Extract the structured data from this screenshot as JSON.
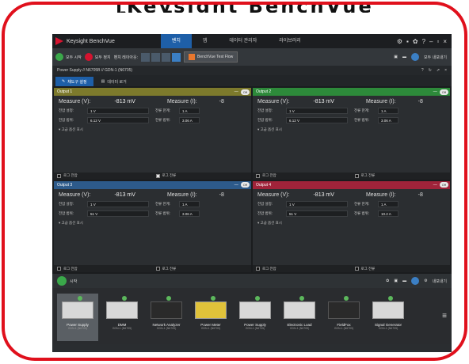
{
  "banner": {
    "text": "[Keysight BenchVue App]"
  },
  "app": {
    "title": "Keysight BenchVue",
    "tabs": [
      "벤치",
      "앱",
      "데이터 관리자",
      "라이브러리"
    ],
    "active_tab": "벤치"
  },
  "toolbar": {
    "start_label": "모두 시작",
    "stop_label": "모두 정지",
    "layout_label": "벤치 레이아웃:",
    "flow_label": "BenchVue Test Flow",
    "export_label": "모두 내보내기"
  },
  "instrument_bar": {
    "title": "Power Supply // N6705B // GDN-1 (N6705)"
  },
  "view_tabs": {
    "settings": "채도구 설정",
    "data_log": "데이터 로거"
  },
  "outputs": [
    {
      "name": "Output 1",
      "color": "#7d7a2c",
      "state": "Off",
      "measure_v_label": "Measure (V):",
      "measure_v": "-813 mV",
      "measure_i_label": "Measure (I):",
      "measure_i_partial": "-8",
      "voltage_set_label": "전압 설정:",
      "voltage_set": "1 V",
      "current_limit_label": "전류 한계:",
      "current_limit": "1 A",
      "voltage_range_label": "전압 범위:",
      "voltage_range": "6.12 V",
      "current_range_label": "전류 범위:",
      "current_range": "3.06 A",
      "advanced_label": "고급 옵션 표시",
      "log_v_label": "로그 전압",
      "log_v_checked": false,
      "log_i_label": "로그 전류",
      "log_i_checked": true
    },
    {
      "name": "Output 2",
      "color": "#2d8a3a",
      "state": "Off",
      "measure_v_label": "Measure (V):",
      "measure_v": "-813 mV",
      "measure_i_label": "Measure (I):",
      "measure_i_partial": "-8",
      "voltage_set_label": "전압 설정:",
      "voltage_set": "1 V",
      "current_limit_label": "전류 한계:",
      "current_limit": "1 A",
      "voltage_range_label": "전압 범위:",
      "voltage_range": "6.12 V",
      "current_range_label": "전류 범위:",
      "current_range": "3.06 A",
      "advanced_label": "고급 옵션 표시",
      "log_v_label": "로그 전압",
      "log_v_checked": false,
      "log_i_label": "로그 전류",
      "log_i_checked": false
    },
    {
      "name": "Output 3",
      "color": "#2d5a8a",
      "state": "Off",
      "measure_v_label": "Measure (V):",
      "measure_v": "-813 mV",
      "measure_i_label": "Measure (I):",
      "measure_i_partial": "-8",
      "voltage_set_label": "전압 설정:",
      "voltage_set": "1 V",
      "current_limit_label": "전류 한계:",
      "current_limit": "1 A",
      "voltage_range_label": "전압 범위:",
      "voltage_range": "51 V",
      "current_range_label": "전류 범위:",
      "current_range": "3.06 A",
      "advanced_label": "고급 옵션 표시",
      "log_v_label": "로그 전압",
      "log_v_checked": false,
      "log_i_label": "로그 전류",
      "log_i_checked": false
    },
    {
      "name": "Output 4",
      "color": "#a0233a",
      "state": "Off",
      "measure_v_label": "Measure (V):",
      "measure_v": "-813 mV",
      "measure_i_label": "Measure (I):",
      "measure_i_partial": "-8",
      "voltage_set_label": "전압 설정:",
      "voltage_set": "1 V",
      "current_limit_label": "전류 한계:",
      "current_limit": "1 A",
      "voltage_range_label": "전압 범위:",
      "voltage_range": "51 V",
      "current_range_label": "전류 범위:",
      "current_range": "10.2 A",
      "advanced_label": "고급 옵션 표시",
      "log_v_label": "로그 전압",
      "log_v_checked": false,
      "log_i_label": "로그 전류",
      "log_i_checked": false
    }
  ],
  "runbar": {
    "run_label": "시작",
    "export_label": "내보내기"
  },
  "dock": {
    "devices": [
      {
        "name": "Power Supply",
        "sub": "GDN-1 (N6705)",
        "style": "light",
        "active": true
      },
      {
        "name": "DMM",
        "sub": "GDN-1 (N6705)",
        "style": "light",
        "active": false
      },
      {
        "name": "Network Analyzer",
        "sub": "GDN-1 (N6705)",
        "style": "dark",
        "active": false
      },
      {
        "name": "Power Meter",
        "sub": "GDN-1 (N6705)",
        "style": "yellow",
        "active": false
      },
      {
        "name": "Power Supply",
        "sub": "GDN-1 (N6705)",
        "style": "light",
        "active": false
      },
      {
        "name": "Electronic Load",
        "sub": "GDN-1 (N6705)",
        "style": "light",
        "active": false
      },
      {
        "name": "FieldFox",
        "sub": "GDN-1 (N6705)",
        "style": "dark",
        "active": false
      },
      {
        "name": "Signal Generator",
        "sub": "GDN-1 (N6705)",
        "style": "light",
        "active": false
      }
    ]
  }
}
